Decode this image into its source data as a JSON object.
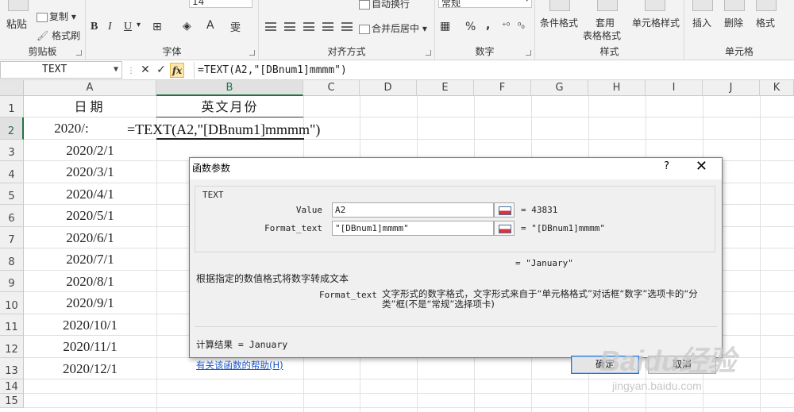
{
  "ribbon": {
    "clipboard": {
      "label": "剪贴板",
      "paste": "粘贴",
      "copy": "复制",
      "format_painter": "格式刷"
    },
    "font": {
      "label": "字体",
      "size": "14",
      "bold": "B",
      "italic": "I",
      "underline": "U",
      "phonetic": "wén"
    },
    "alignment": {
      "label": "对齐方式",
      "wrap": "自动换行",
      "merge": "合并后居中"
    },
    "number": {
      "label": "数字",
      "format": "常规",
      "percent": "%",
      "comma": ","
    },
    "styles": {
      "label": "样式",
      "conditional": "条件格式",
      "table": "套用",
      "table2": "表格格式",
      "cell_styles": "单元格样式"
    },
    "cells": {
      "label": "单元格",
      "insert": "插入",
      "delete": "删除",
      "format": "格式"
    }
  },
  "formula_bar": {
    "name_box": "TEXT",
    "cancel": "✕",
    "enter": "✓",
    "fx": "fx",
    "formula": "=TEXT(A2,\"[DBnum1]mmmm\")"
  },
  "grid": {
    "columns": [
      "A",
      "B",
      "C",
      "D",
      "E",
      "F",
      "G",
      "H",
      "I",
      "J",
      "K"
    ],
    "rows": [
      "1",
      "2",
      "3",
      "4",
      "5",
      "6",
      "7",
      "8",
      "9",
      "10",
      "11",
      "12",
      "13",
      "14",
      "15"
    ],
    "a1": "日期",
    "b1": "英文月份",
    "a2_partial": "2020/:",
    "edit_text": "=TEXT(A2,\"[DBnum1]mmmm\")",
    "dates": [
      "2020/2/1",
      "2020/3/1",
      "2020/4/1",
      "2020/5/1",
      "2020/6/1",
      "2020/7/1",
      "2020/8/1",
      "2020/9/1",
      "2020/10/1",
      "2020/11/1",
      "2020/12/1"
    ]
  },
  "dialog": {
    "title": "函数参数",
    "help": "?",
    "close": "✕",
    "function_name": "TEXT",
    "args": [
      {
        "label": "Value",
        "value": "A2",
        "result": "=  43831"
      },
      {
        "label": "Format_text",
        "value": "\"[DBnum1]mmmm\"",
        "result": "=  \"[DBnum1]mmmm\""
      }
    ],
    "function_result": "=  \"January\"",
    "function_desc": "根据指定的数值格式将数字转成文本",
    "arg_name": "Format_text",
    "arg_desc": "文字形式的数字格式，文字形式来自于“单元格格式”对话框“数字”选项卡的“分类”框(不是“常规”选择项卡)",
    "calc_result": "计算结果 =  January",
    "help_link": "有关该函数的帮助(H)",
    "ok": "确定",
    "cancel": "取消"
  },
  "watermark": {
    "main": "Baidu经验",
    "sub": "jingyan.baidu.com"
  }
}
